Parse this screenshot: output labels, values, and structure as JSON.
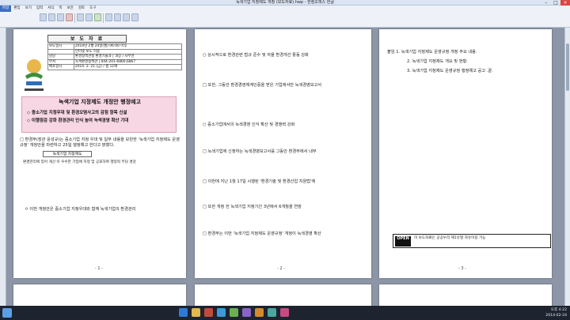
{
  "window": {
    "title": "녹색기업 지정제도 개정 (보도자료).hwp - 한컴오피스 한글"
  },
  "menu": [
    "파일",
    "편집",
    "보기",
    "입력",
    "서식",
    "쪽",
    "보안",
    "검토",
    "도구"
  ],
  "page1": {
    "press_label": "보 도 자 료",
    "meta_rows": [
      [
        "보도일시",
        "2014년 2월 24일(월) 06:00 이후"
      ],
      [
        "",
        "인터넷 보도 허용"
      ],
      [
        "담당",
        "환경정책관실 환경기술과 | 과장 / 사무관"
      ],
      [
        "부서",
        "녹색환경정책관 | 044-201-6860,6867"
      ],
      [
        "배포일시",
        "2014. 2. 21.(금) / 총 11매"
      ]
    ],
    "headline": "녹색기업 지정제도 개정안 행정예고",
    "bullets": [
      "◇ 중소기업 지정우대 및 환경오염사고의 감점 항목 신설",
      "◇ 이행점검 강화 환경관리 인식 높여 녹색경영 확산 기대"
    ],
    "para1": "□ 환경부(장관 윤성규)는 중소기업 지정 우대 및 일부 내용을 보완한 '녹색기업 지정제도 운영 규정' 개정안을 마련하고 25일 행정예고 한다고 밝혔다.",
    "subhead": "녹색기업 지정제도",
    "note1": "환경관리에 있어 개선 이 우수한 기업에 지정 및 공표하여 행정적 부담 경감",
    "note2": "ㅇ 이번 개정안은 중소기업 지정우대와 함께 녹색기업의 환경관리",
    "page_no": "- 1 -"
  },
  "page2": {
    "lines": [
      "○ 상시적으로 환경관련 법규 준수 및 자율 환경개선 활동 강화",
      "□ 또한, 그동안 환경경영체계인증을 받은 기업에서만 녹색경영보고서",
      "○ 중소기업에서의 녹색경영 인식 확산 및 경쟁력 강화",
      "□ 녹색기업에 신청하는 녹색경영보고서를 그동안 환경부에서 내부",
      "□ 이번에 지난 1월 17일 시행된 '환경기술 및 환경산업 지원법'에",
      "□ 또한 개정 전 녹색기업 지정기간 3년에서 6개월을 연장",
      "□ 환경부는 이번 '녹색기업 지정제도 운영규정' 개정이 녹색경영 확산"
    ],
    "page_no": "- 2 -"
  },
  "page3": {
    "attach": "붙임  1. 녹색기업 지정제도 운영규정 개정 주요 내용.",
    "attach2": "2. 녹색기업 지정제도 개요 및 현황.",
    "attach3": "3. 녹색기업 지정제도 운영규정 행정예고 공고 .끝.",
    "open_label": "OPEN",
    "open_text": "이 보도자료는 공공누리 제1유형 자유이용 가능",
    "page_no": "- 3 -"
  },
  "taskbar": {
    "time": "오후 4:22",
    "date": "2014-02-24"
  }
}
